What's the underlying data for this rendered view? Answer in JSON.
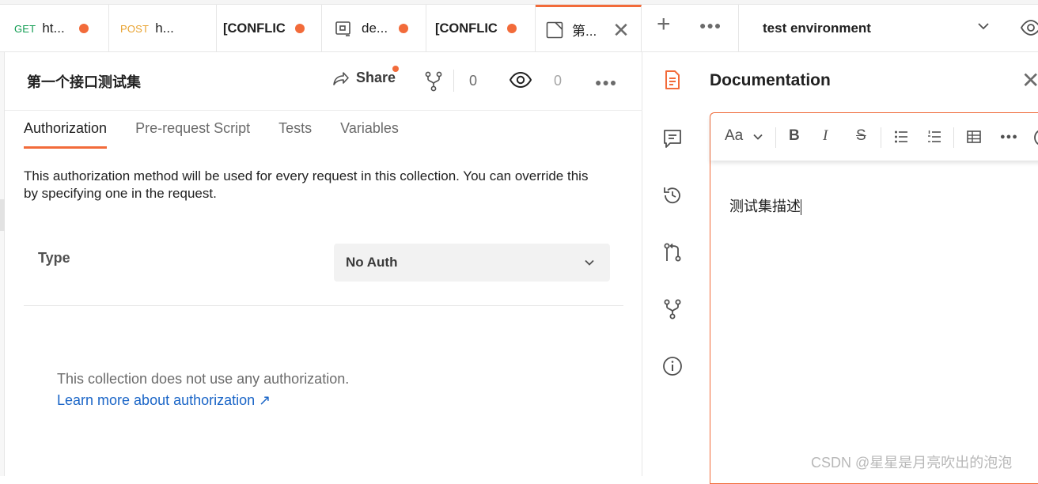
{
  "tabs": [
    {
      "method": "GET",
      "label": "ht...",
      "unsaved": true
    },
    {
      "method": "POST",
      "label": "h...",
      "unsaved": false
    },
    {
      "label": "[CONFLIC",
      "unsaved": true
    },
    {
      "label": "de...",
      "unsaved": true
    },
    {
      "label": "[CONFLIC",
      "unsaved": true
    },
    {
      "label": "第...",
      "active": true
    }
  ],
  "environment": {
    "name": "test environment"
  },
  "collection": {
    "title": "第一个接口测试集",
    "share_label": "Share",
    "fork_count": "0",
    "watch_count": "0"
  },
  "subtabs": [
    "Authorization",
    "Pre-request Script",
    "Tests",
    "Variables"
  ],
  "auth": {
    "description": "This authorization method will be used for every request in this collection. You can override this by specifying one in the request.",
    "type_label": "Type",
    "type_value": "No Auth",
    "note": "This collection does not use any authorization.",
    "learn_more": "Learn more about authorization ↗"
  },
  "documentation": {
    "title": "Documentation",
    "toolbar": {
      "font": "Aa",
      "bold": "B",
      "italic": "I",
      "strike": "S"
    },
    "content": "测试集描述"
  },
  "watermark": "CSDN @星星是月亮吹出的泡泡",
  "colors": {
    "accent": "#f26b3a",
    "link": "#1a65c7",
    "get": "#0d9b4f",
    "post": "#e8a22f"
  }
}
